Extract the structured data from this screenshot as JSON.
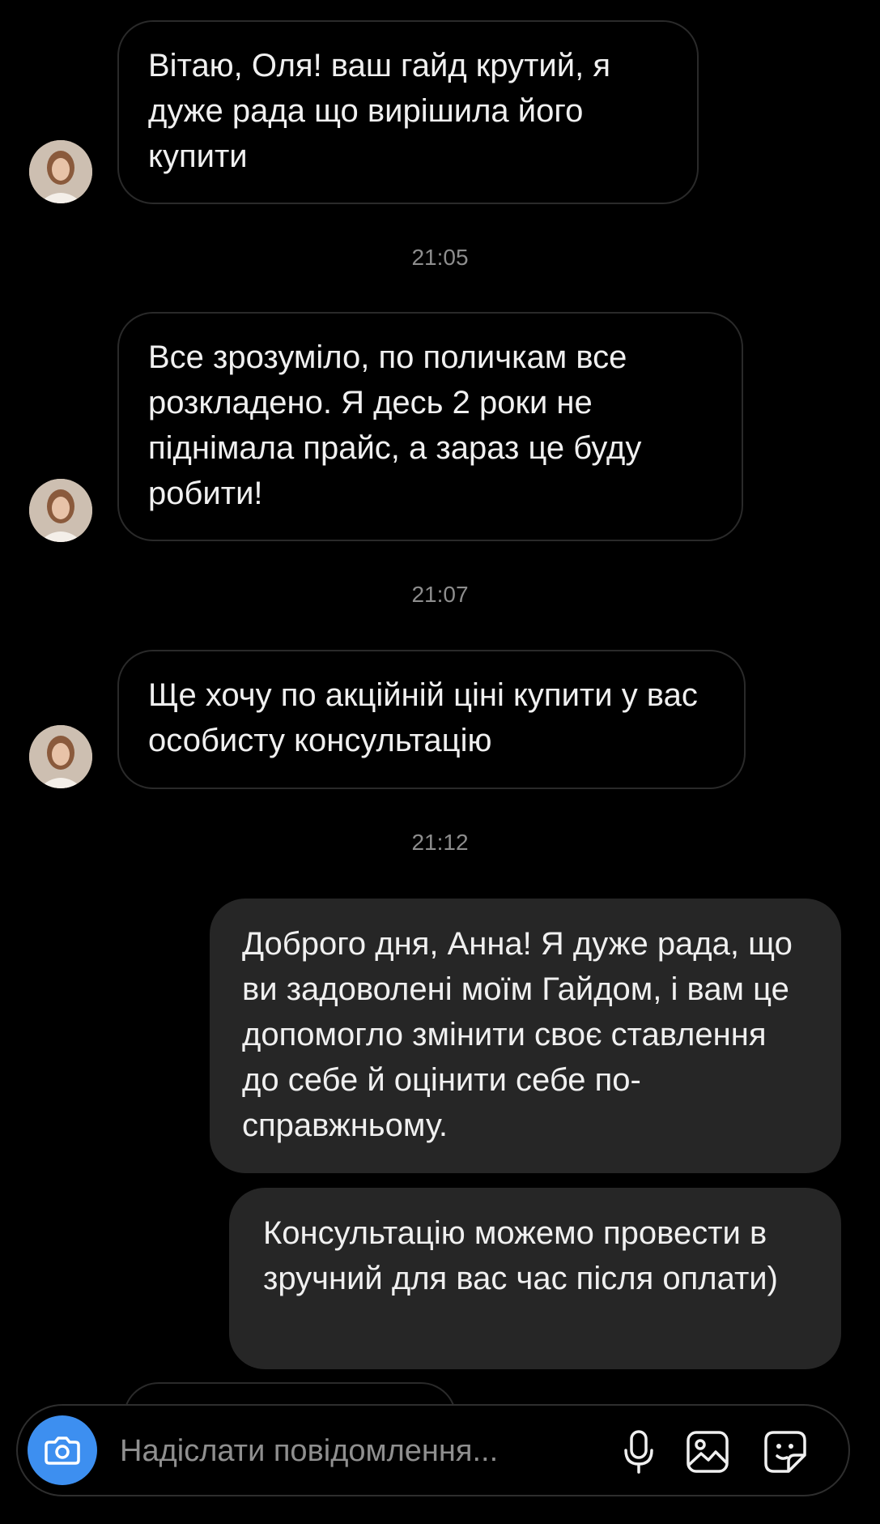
{
  "messages": [
    {
      "text": "Вітаю, Оля! ваш гайд крутий, я дуже рада що вирішила його купити"
    },
    {
      "text": "Все зрозуміло, по поличкам все розкладено. Я десь 2 роки не піднімала прайс, а зараз це буду робити!"
    },
    {
      "text": "Ще хочу по акційній ціні купити у вас особисту консультацію"
    },
    {
      "text": "Доброго дня, Анна! Я дуже рада, що ви задоволені моїм Гайдом, і вам це допомогло змінити своє ставлення до себе й оцінити себе по-справжньому."
    },
    {
      "text": "Консультацію можемо провести в зручний для вас час після оплати)"
    }
  ],
  "timestamps": [
    "21:05",
    "21:07",
    "21:12"
  ],
  "composer": {
    "placeholder": "Надіслати повідомлення...",
    "icons": [
      "camera-icon",
      "microphone-icon",
      "gallery-icon",
      "sticker-icon"
    ],
    "accent_color": "#3d8ff0"
  },
  "colors": {
    "background": "#000000",
    "outgoing_bubble": "#262626",
    "incoming_border": "#2a2a2a",
    "timestamp": "#8d8d8d"
  }
}
